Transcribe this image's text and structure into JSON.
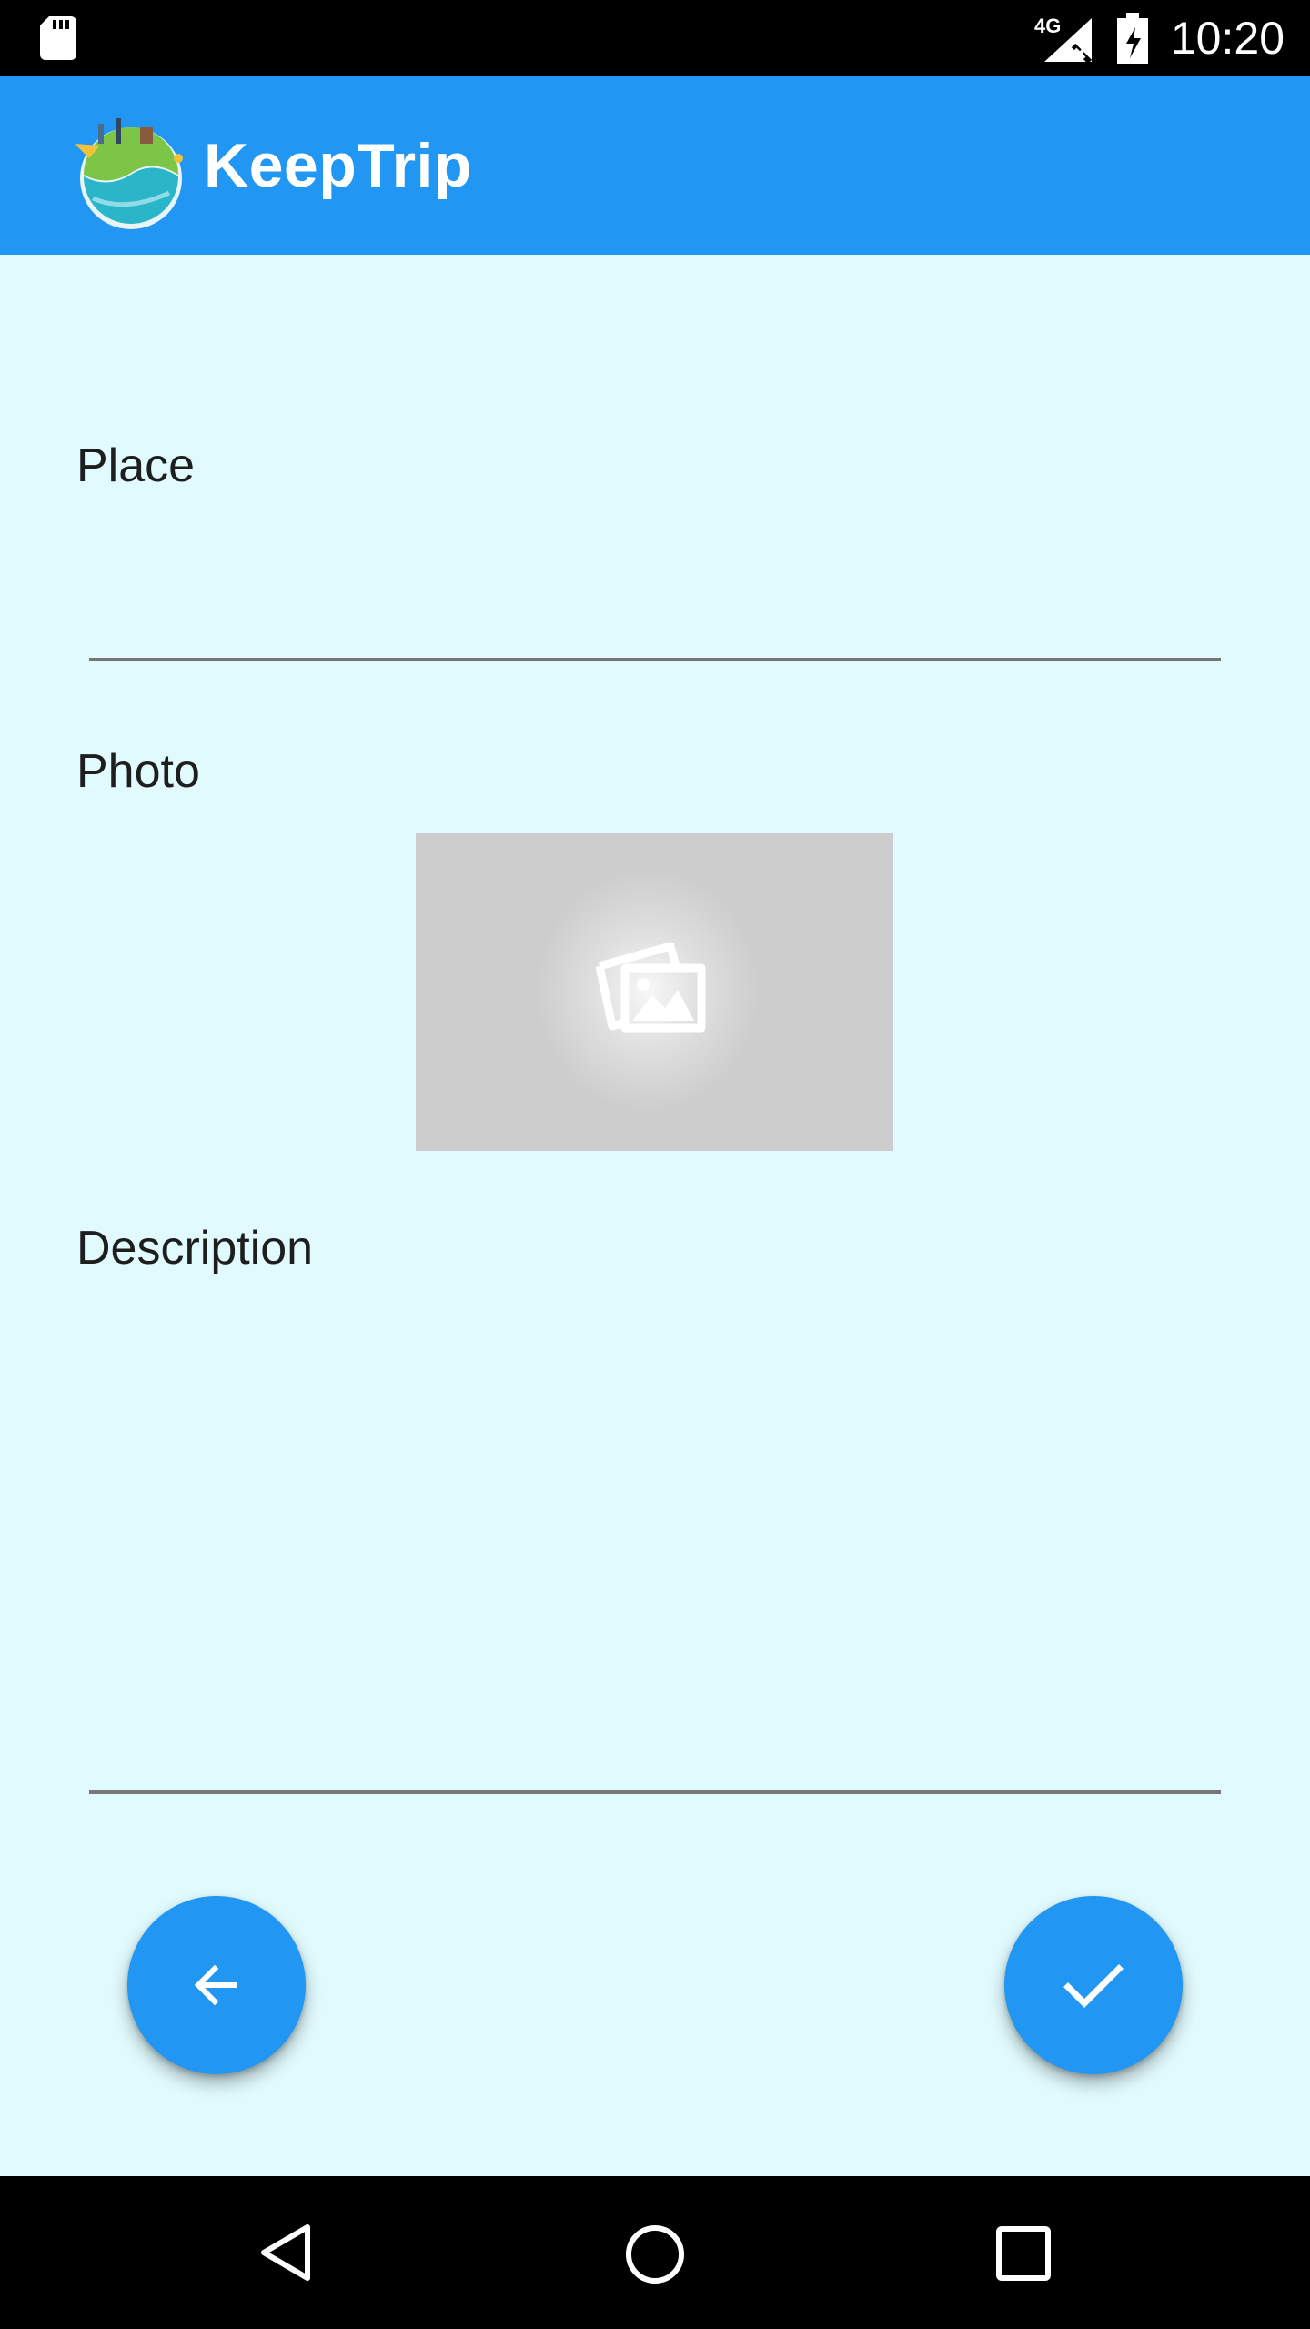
{
  "status_bar": {
    "time": "10:20",
    "network": "4G",
    "icons": [
      "sd-card-icon",
      "signal-icon",
      "battery-icon"
    ]
  },
  "app_bar": {
    "title": "KeepTrip",
    "logo": "keeptrip-globe-logo"
  },
  "form": {
    "place_label": "Place",
    "place_value": "",
    "photo_label": "Photo",
    "photo_icon": "image-placeholder-icon",
    "description_label": "Description",
    "description_value": ""
  },
  "actions": {
    "back_icon": "arrow-left-icon",
    "confirm_icon": "check-icon"
  },
  "nav_bar": {
    "icons": [
      "back-triangle-icon",
      "home-circle-icon",
      "recents-square-icon"
    ]
  },
  "colors": {
    "primary": "#2196f3",
    "background": "#e0fafe",
    "placeholder": "#cdcdcd"
  }
}
